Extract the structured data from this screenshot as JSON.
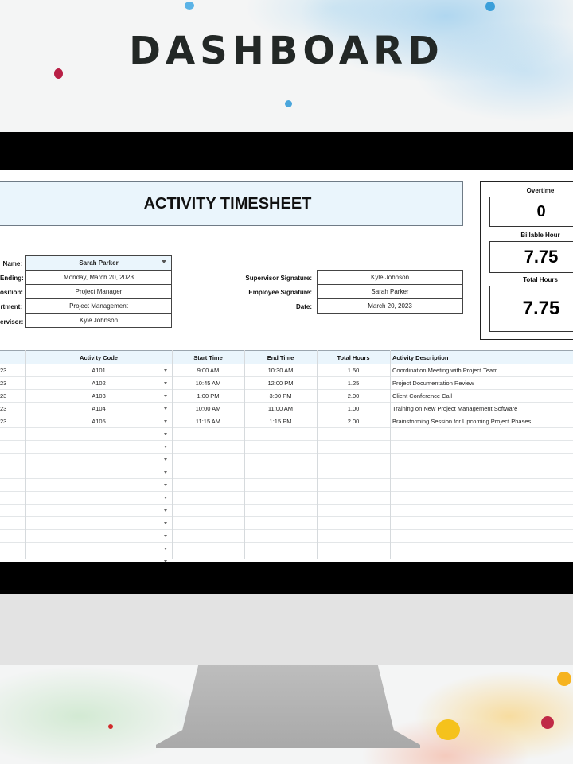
{
  "page_title": "DASHBOARD",
  "sheet": {
    "title": "ACTIVITY TIMESHEET",
    "fields_left": [
      {
        "label": "Name:",
        "value": "Sarah Parker"
      },
      {
        "label": "Ending:",
        "value": "Monday, March 20, 2023"
      },
      {
        "label": "osition:",
        "value": "Project Manager"
      },
      {
        "label": "rtment:",
        "value": "Project Management"
      },
      {
        "label": "ervisor:",
        "value": "Kyle Johnson"
      }
    ],
    "fields_right": [
      {
        "label": "Supervisor Signature:",
        "value": "Kyle Johnson"
      },
      {
        "label": "Employee Signature:",
        "value": "Sarah Parker"
      },
      {
        "label": "Date:",
        "value": "March 20, 2023"
      }
    ],
    "stats": [
      {
        "label": "Overtime",
        "value": "0"
      },
      {
        "label": "Billable Hour",
        "value": "7.75"
      },
      {
        "label": "Total Hours",
        "value": "7.75"
      }
    ],
    "table": {
      "columns": [
        "",
        "Activity Code",
        "Start Time",
        "End Time",
        "Total Hours",
        "Activity Description"
      ],
      "rows": [
        [
          "23",
          "A101",
          "9:00 AM",
          "10:30 AM",
          "1.50",
          "Coordination Meeting with Project Team"
        ],
        [
          "23",
          "A102",
          "10:45 AM",
          "12:00 PM",
          "1.25",
          "Project Documentation Review"
        ],
        [
          "23",
          "A103",
          "1:00 PM",
          "3:00 PM",
          "2.00",
          "Client Conference Call"
        ],
        [
          "23",
          "A104",
          "10:00 AM",
          "11:00 AM",
          "1.00",
          "Training on New Project Management Software"
        ],
        [
          "23",
          "A105",
          "11:15 AM",
          "1:15 PM",
          "2.00",
          "Brainstorming Session for Upcoming Project Phases"
        ]
      ],
      "empty_rows": 11
    }
  }
}
